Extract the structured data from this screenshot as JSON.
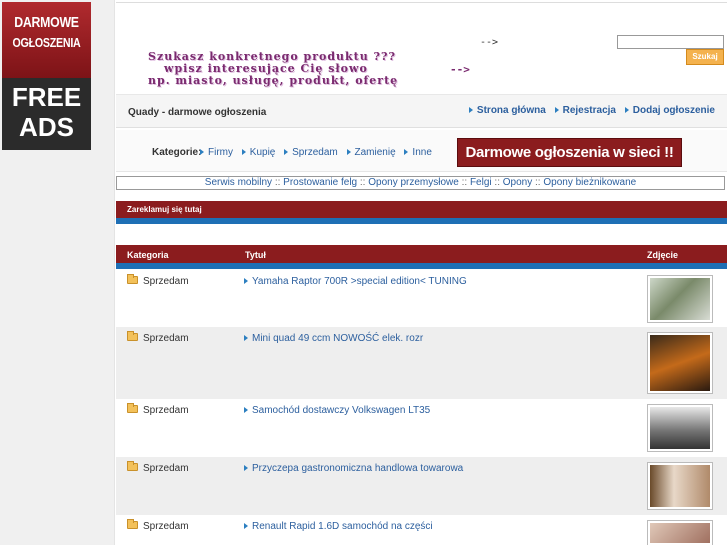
{
  "logo": {
    "line1": "DARMOWE",
    "line2": "OGŁOSZENIA",
    "line3": "FREE",
    "line4": "ADS"
  },
  "header": {
    "arrow_top": "-->",
    "banner_line1": "Szukasz konkretnego produktu ???",
    "banner_line2": "wpisz interesujące Cię słowo",
    "banner_line3": "np. miasto, usługę, produkt, ofertę",
    "banner_arrow": "-->",
    "search_value": "",
    "search_button": "Szukaj"
  },
  "crumb": {
    "page_title": "Quady - darmowe ogłoszenia",
    "nav": [
      {
        "label": "Strona główna"
      },
      {
        "label": "Rejestracja"
      },
      {
        "label": "Dodaj ogłoszenie"
      }
    ]
  },
  "categories": {
    "label": "Kategorie:",
    "items": [
      "Firmy",
      "Kupię",
      "Sprzedam",
      "Zamienię",
      "Inne"
    ],
    "promo": "Darmowe ogłoszenia w sieci !!"
  },
  "linkbar": {
    "items": [
      "Serwis mobilny",
      "Prostowanie felg",
      "Opony przemysłowe",
      "Felgi",
      "Opony",
      "Opony bieżnikowane"
    ],
    "separator": "::"
  },
  "ad": {
    "heading": "Zareklamuj się tutaj"
  },
  "table": {
    "headers": {
      "category": "Kategoria",
      "title": "Tytuł",
      "photo": "Zdjęcie"
    },
    "rows": [
      {
        "category": "Sprzedam",
        "title": "Yamaha Raptor 700R >special edition< TUNING",
        "thumb_color": "#7a8a6a"
      },
      {
        "category": "Sprzedam",
        "title": "Mini quad 49 ccm NOWOŚĆ elek. rozr",
        "thumb_color": "#8a4a1a"
      },
      {
        "category": "Sprzedam",
        "title": "Samochód dostawczy Volkswagen LT35",
        "thumb_color": "#777777"
      },
      {
        "category": "Sprzedam",
        "title": "Przyczepa gastronomiczna handlowa towarowa",
        "thumb_color": "#b08a6a"
      },
      {
        "category": "Sprzedam",
        "title": "Renault Rapid 1.6D samochód na części",
        "thumb_color": "#a07060"
      }
    ]
  },
  "colors": {
    "accent_red": "#8b1c1e",
    "accent_blue": "#1e6fb5",
    "link": "#2c5f9e",
    "search_button": "#f4b24e"
  }
}
